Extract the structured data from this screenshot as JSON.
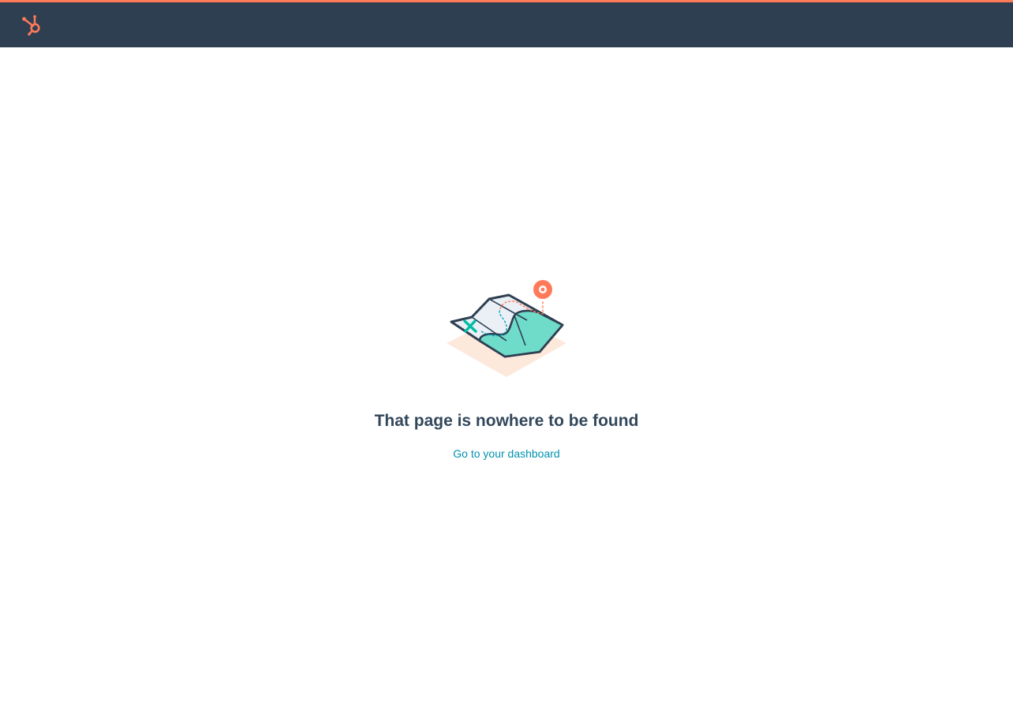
{
  "header": {
    "logo_icon": "hubspot-sprocket-icon",
    "accent_color": "#ff7a59",
    "background_color": "#2e3f51"
  },
  "main": {
    "illustration_icon": "folded-map-with-pin-icon",
    "headline": "That page is nowhere to be found",
    "dashboard_link_label": "Go to your dashboard",
    "link_color": "#0091ae",
    "headline_color": "#33475b"
  }
}
